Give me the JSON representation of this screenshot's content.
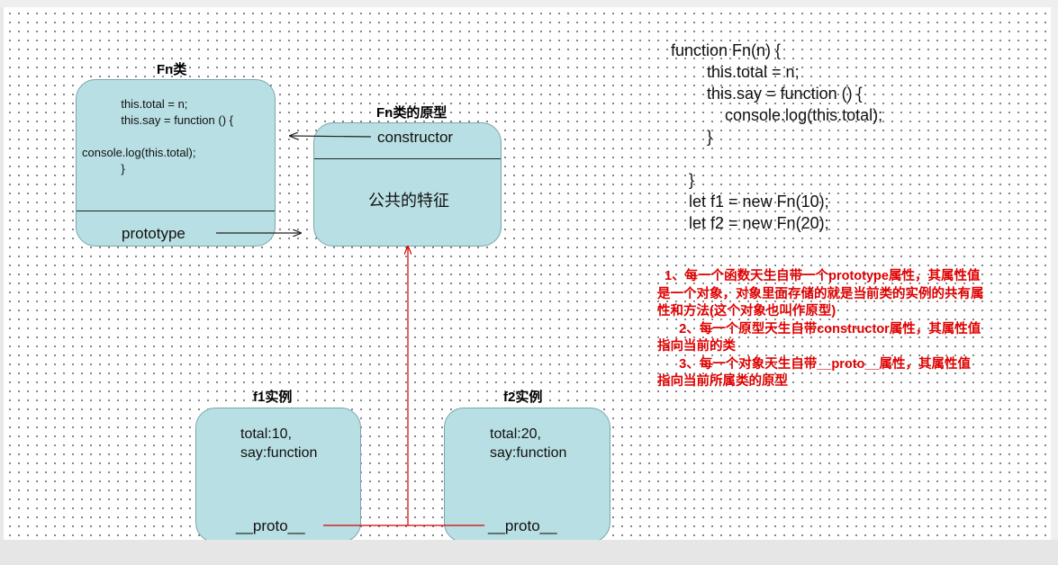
{
  "fn_class": {
    "title": "Fn类",
    "body_lines": [
      "            this.total = n;",
      "            this.say = function () {",
      "",
      "console.log(this.total);",
      "            }"
    ],
    "prototype_label": "prototype"
  },
  "prototype_box": {
    "title": "Fn类的原型",
    "constructor_label": "constructor",
    "body_label": "公共的特征"
  },
  "instance_f1": {
    "title": "f1实例",
    "line1": "total:10,",
    "line2": "say:function",
    "proto_label": "__proto__"
  },
  "instance_f2": {
    "title": "f2实例",
    "line1": "total:20,",
    "line2": "say:function",
    "proto_label": "__proto__"
  },
  "code_block": {
    "lines": [
      "function Fn(n) {",
      "        this.total = n;",
      "        this.say = function () {",
      "            console.log(this.total);",
      "        }",
      "",
      "    }",
      "    let f1 = new Fn(10);",
      "    let f2 = new Fn(20);"
    ]
  },
  "notes": {
    "lines": [
      "  1、每一个函数天生自带一个prototype属性，其属性值",
      "是一个对象，对象里面存储的就是当前类的实例的共有属",
      "性和方法(这个对象也叫作原型)",
      "      2、每一个原型天生自带constructor属性，其属性值",
      "指向当前的类",
      "      3、每一个对象天生自带__proto__属性，其属性值",
      "指向当前所属类的原型"
    ]
  },
  "colors": {
    "box_fill": "#b8dfe3",
    "note_red": "#e00000",
    "arrow_red": "#d40000"
  }
}
